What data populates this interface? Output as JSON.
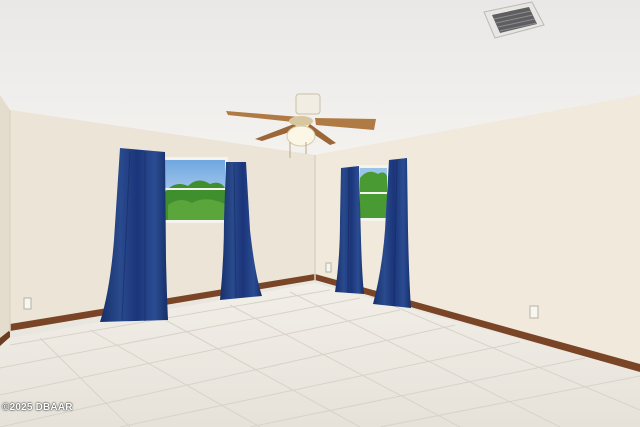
{
  "watermark": {
    "text": "©2025 DBAAR"
  },
  "scene": {
    "description_icons": [
      "ceiling-fan-icon",
      "air-vent-icon"
    ],
    "colors": {
      "ceiling": "#f1efec",
      "left_wall": "#ece4d6",
      "back_wall": "#ebe2d1",
      "right_wall": "#f0e9dc",
      "floor": "#ece9e2",
      "baseboard": "#7a4526",
      "curtain": "#1e3a78",
      "fan_blade": "#b07a44"
    }
  }
}
